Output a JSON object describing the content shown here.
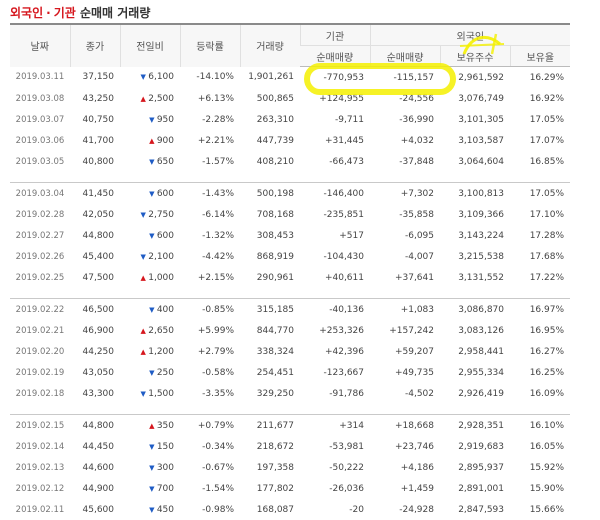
{
  "title": {
    "part1": "외국인",
    "sep": "·",
    "part2": "기관",
    "rest": "순매매 거래량"
  },
  "headers": {
    "date": "날짜",
    "close": "종가",
    "change": "전일비",
    "rate": "등락률",
    "volume": "거래량",
    "inst": "기관",
    "foreign": "외국인",
    "inst_net": "순매매량",
    "foreign_net": "순매매량",
    "foreign_hold": "보유주수",
    "foreign_ratio": "보유율"
  },
  "colors": {
    "up": "#d6171e",
    "down": "#1f5cc5",
    "highlighter": "#f4f000"
  },
  "groups": [
    [
      {
        "date": "2019.03.11",
        "close": "37,150",
        "dir": "down",
        "change": "6,100",
        "rate": "-14.10%",
        "volume": "1,901,261",
        "inst": "-770,953",
        "foreign": "-115,157",
        "hold": "2,961,592",
        "ratio": "16.29%"
      },
      {
        "date": "2019.03.08",
        "close": "43,250",
        "dir": "up",
        "change": "2,500",
        "rate": "+6.13%",
        "volume": "500,865",
        "inst": "+124,955",
        "foreign": "-24,556",
        "hold": "3,076,749",
        "ratio": "16.92%"
      },
      {
        "date": "2019.03.07",
        "close": "40,750",
        "dir": "down",
        "change": "950",
        "rate": "-2.28%",
        "volume": "263,310",
        "inst": "-9,711",
        "foreign": "-36,990",
        "hold": "3,101,305",
        "ratio": "17.05%"
      },
      {
        "date": "2019.03.06",
        "close": "41,700",
        "dir": "up",
        "change": "900",
        "rate": "+2.21%",
        "volume": "447,739",
        "inst": "+31,445",
        "foreign": "+4,032",
        "hold": "3,103,587",
        "ratio": "17.07%"
      },
      {
        "date": "2019.03.05",
        "close": "40,800",
        "dir": "down",
        "change": "650",
        "rate": "-1.57%",
        "volume": "408,210",
        "inst": "-66,473",
        "foreign": "-37,848",
        "hold": "3,064,604",
        "ratio": "16.85%"
      }
    ],
    [
      {
        "date": "2019.03.04",
        "close": "41,450",
        "dir": "down",
        "change": "600",
        "rate": "-1.43%",
        "volume": "500,198",
        "inst": "-146,400",
        "foreign": "+7,302",
        "hold": "3,100,813",
        "ratio": "17.05%"
      },
      {
        "date": "2019.02.28",
        "close": "42,050",
        "dir": "down",
        "change": "2,750",
        "rate": "-6.14%",
        "volume": "708,168",
        "inst": "-235,851",
        "foreign": "-35,858",
        "hold": "3,109,366",
        "ratio": "17.10%"
      },
      {
        "date": "2019.02.27",
        "close": "44,800",
        "dir": "down",
        "change": "600",
        "rate": "-1.32%",
        "volume": "308,453",
        "inst": "+517",
        "foreign": "-6,095",
        "hold": "3,143,224",
        "ratio": "17.28%"
      },
      {
        "date": "2019.02.26",
        "close": "45,400",
        "dir": "down",
        "change": "2,100",
        "rate": "-4.42%",
        "volume": "868,919",
        "inst": "-104,430",
        "foreign": "-4,007",
        "hold": "3,215,538",
        "ratio": "17.68%"
      },
      {
        "date": "2019.02.25",
        "close": "47,500",
        "dir": "up",
        "change": "1,000",
        "rate": "+2.15%",
        "volume": "290,961",
        "inst": "+40,611",
        "foreign": "+37,641",
        "hold": "3,131,552",
        "ratio": "17.22%"
      }
    ],
    [
      {
        "date": "2019.02.22",
        "close": "46,500",
        "dir": "down",
        "change": "400",
        "rate": "-0.85%",
        "volume": "315,185",
        "inst": "-40,136",
        "foreign": "+1,083",
        "hold": "3,086,870",
        "ratio": "16.97%"
      },
      {
        "date": "2019.02.21",
        "close": "46,900",
        "dir": "up",
        "change": "2,650",
        "rate": "+5.99%",
        "volume": "844,770",
        "inst": "+253,326",
        "foreign": "+157,242",
        "hold": "3,083,126",
        "ratio": "16.95%"
      },
      {
        "date": "2019.02.20",
        "close": "44,250",
        "dir": "up",
        "change": "1,200",
        "rate": "+2.79%",
        "volume": "338,324",
        "inst": "+42,396",
        "foreign": "+59,207",
        "hold": "2,958,441",
        "ratio": "16.27%"
      },
      {
        "date": "2019.02.19",
        "close": "43,050",
        "dir": "down",
        "change": "250",
        "rate": "-0.58%",
        "volume": "254,451",
        "inst": "-123,667",
        "foreign": "+49,735",
        "hold": "2,955,334",
        "ratio": "16.25%"
      },
      {
        "date": "2019.02.18",
        "close": "43,300",
        "dir": "down",
        "change": "1,500",
        "rate": "-3.35%",
        "volume": "329,250",
        "inst": "-91,786",
        "foreign": "-4,502",
        "hold": "2,926,419",
        "ratio": "16.09%"
      }
    ],
    [
      {
        "date": "2019.02.15",
        "close": "44,800",
        "dir": "up",
        "change": "350",
        "rate": "+0.79%",
        "volume": "211,677",
        "inst": "+314",
        "foreign": "+18,668",
        "hold": "2,928,351",
        "ratio": "16.10%"
      },
      {
        "date": "2019.02.14",
        "close": "44,450",
        "dir": "down",
        "change": "150",
        "rate": "-0.34%",
        "volume": "218,672",
        "inst": "-53,981",
        "foreign": "+23,746",
        "hold": "2,919,683",
        "ratio": "16.05%"
      },
      {
        "date": "2019.02.13",
        "close": "44,600",
        "dir": "down",
        "change": "300",
        "rate": "-0.67%",
        "volume": "197,358",
        "inst": "-50,222",
        "foreign": "+4,186",
        "hold": "2,895,937",
        "ratio": "15.92%"
      },
      {
        "date": "2019.02.12",
        "close": "44,900",
        "dir": "down",
        "change": "700",
        "rate": "-1.54%",
        "volume": "177,802",
        "inst": "-26,036",
        "foreign": "+1,459",
        "hold": "2,891,001",
        "ratio": "15.90%"
      },
      {
        "date": "2019.02.11",
        "close": "45,600",
        "dir": "down",
        "change": "450",
        "rate": "-0.98%",
        "volume": "168,087",
        "inst": "-20",
        "foreign": "-24,928",
        "hold": "2,847,593",
        "ratio": "15.66%"
      }
    ]
  ]
}
